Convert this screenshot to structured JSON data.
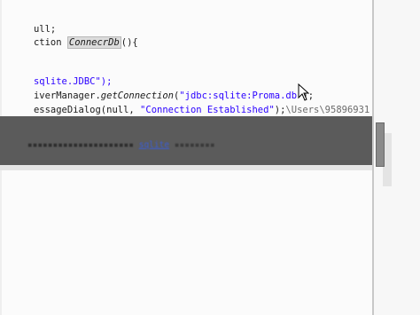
{
  "editor": {
    "line1": "ull;",
    "line2_prefix": "ction ",
    "line2_method": "ConnecrDb",
    "line2_suffix": "(){",
    "line3_str": "sqlite.JDBC\");",
    "line4_prefix": "iverManager.",
    "line4_method": "getConnection",
    "line4_paren": "(",
    "line4_str": "\"jdbc:sqlite:Proma.db\"",
    "line4_suffix": ");",
    "line5_prefix": "essageDialog(null, ",
    "line5_str": "\"Connection Established\"",
    "line5_suffix": ");",
    "line5_path": "\\Users\\95896931"
  },
  "console": {
    "text": "...",
    "link": "sqlite"
  },
  "cursor": {
    "icon": "mouse-pointer-icon"
  }
}
